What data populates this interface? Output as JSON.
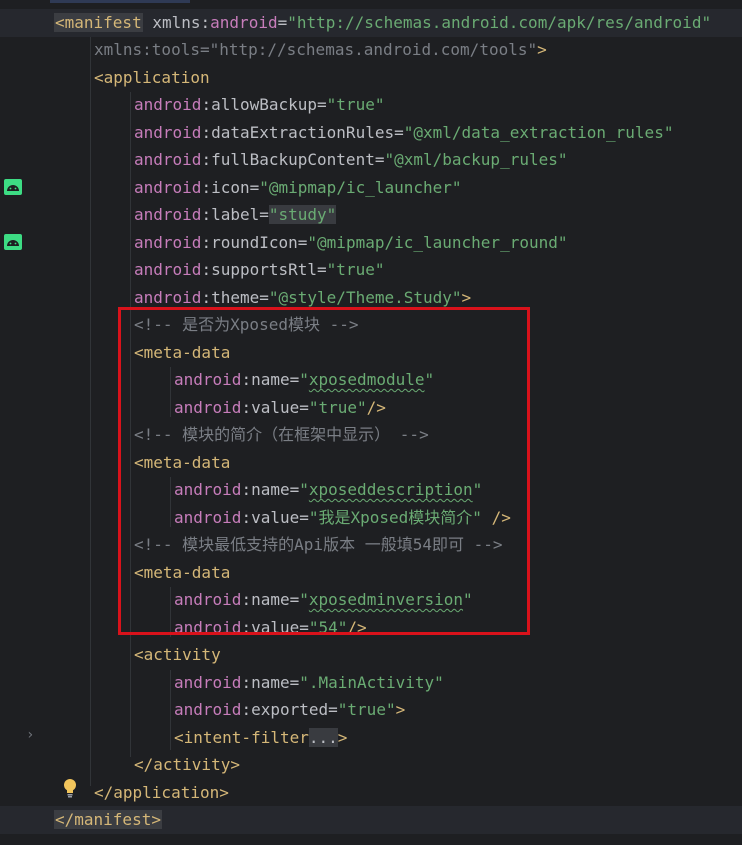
{
  "lines": {
    "l1": {
      "tag_open": "<manifest",
      "ns": "xmlns",
      "colon": ":",
      "attr": "android",
      "eq": "=",
      "value": "\"http://schemas.android.com/apk/res/android\""
    },
    "l2": {
      "text": "xmlns:tools=\"http://schemas.android.com/tools\"",
      "close": ">"
    },
    "l3": {
      "tag": "<application"
    },
    "l4": {
      "ns": "android",
      "attr": ":allowBackup",
      "eq": "=",
      "value": "\"true\""
    },
    "l5": {
      "ns": "android",
      "attr": ":dataExtractionRules",
      "eq": "=",
      "value": "\"@xml/data_extraction_rules\""
    },
    "l6": {
      "ns": "android",
      "attr": ":fullBackupContent",
      "eq": "=",
      "value": "\"@xml/backup_rules\""
    },
    "l7": {
      "ns": "android",
      "attr": ":icon",
      "eq": "=",
      "value": "\"@mipmap/ic_launcher\""
    },
    "l8": {
      "ns": "android",
      "attr": ":label",
      "eq": "=",
      "value": "\"study\""
    },
    "l9": {
      "ns": "android",
      "attr": ":roundIcon",
      "eq": "=",
      "value": "\"@mipmap/ic_launcher_round\""
    },
    "l10": {
      "ns": "android",
      "attr": ":supportsRtl",
      "eq": "=",
      "value": "\"true\""
    },
    "l11": {
      "ns": "android",
      "attr": ":theme",
      "eq": "=",
      "value": "\"@style/Theme.Study\"",
      "close": ">"
    },
    "l12": {
      "comment": "<!-- 是否为Xposed模块 -->"
    },
    "l13": {
      "tag": "<meta-data"
    },
    "l14": {
      "ns": "android",
      "attr": ":name",
      "eq": "=",
      "q1": "\"",
      "value": "xposedmodule",
      "q2": "\""
    },
    "l15": {
      "ns": "android",
      "attr": ":value",
      "eq": "=",
      "value": "\"true\"",
      "close": "/>"
    },
    "l16": {
      "comment": "<!-- 模块的简介（在框架中显示） -->"
    },
    "l17": {
      "tag": "<meta-data"
    },
    "l18": {
      "ns": "android",
      "attr": ":name",
      "eq": "=",
      "q1": "\"",
      "value": "xposeddescription",
      "q2": "\""
    },
    "l19": {
      "ns": "android",
      "attr": ":value",
      "eq": "=",
      "value": "\"我是Xposed模块简介\"",
      "close": " />"
    },
    "l20": {
      "comment": "<!-- 模块最低支持的Api版本 一般填54即可 -->"
    },
    "l21": {
      "tag": "<meta-data"
    },
    "l22": {
      "ns": "android",
      "attr": ":name",
      "eq": "=",
      "q1": "\"",
      "value": "xposedminversion",
      "q2": "\""
    },
    "l23": {
      "ns": "android",
      "attr": ":value",
      "eq": "=",
      "value": "\"54\"",
      "close": "/>"
    },
    "l24": {
      "tag": "<activity"
    },
    "l25": {
      "ns": "android",
      "attr": ":name",
      "eq": "=",
      "value": "\".MainActivity\""
    },
    "l26": {
      "ns": "android",
      "attr": ":exported",
      "eq": "=",
      "value": "\"true\"",
      "close": ">"
    },
    "l27": {
      "tag": "<intent-filter",
      "fold": "...",
      "close": ">"
    },
    "l28": {
      "tag": "</activity>"
    },
    "l29": {
      "tag": "</application>"
    },
    "l30": {
      "tag": "</manifest>"
    }
  },
  "colors": {
    "background": "#1e1f22",
    "tag": "#d5b778",
    "namespace": "#c77dbb",
    "string": "#6aab73",
    "comment": "#7a7e85",
    "highlight_box": "#d9121b"
  },
  "gutter_icons": [
    "android-icon",
    "android-icon",
    "chevron-right-icon",
    "lightbulb-icon"
  ]
}
